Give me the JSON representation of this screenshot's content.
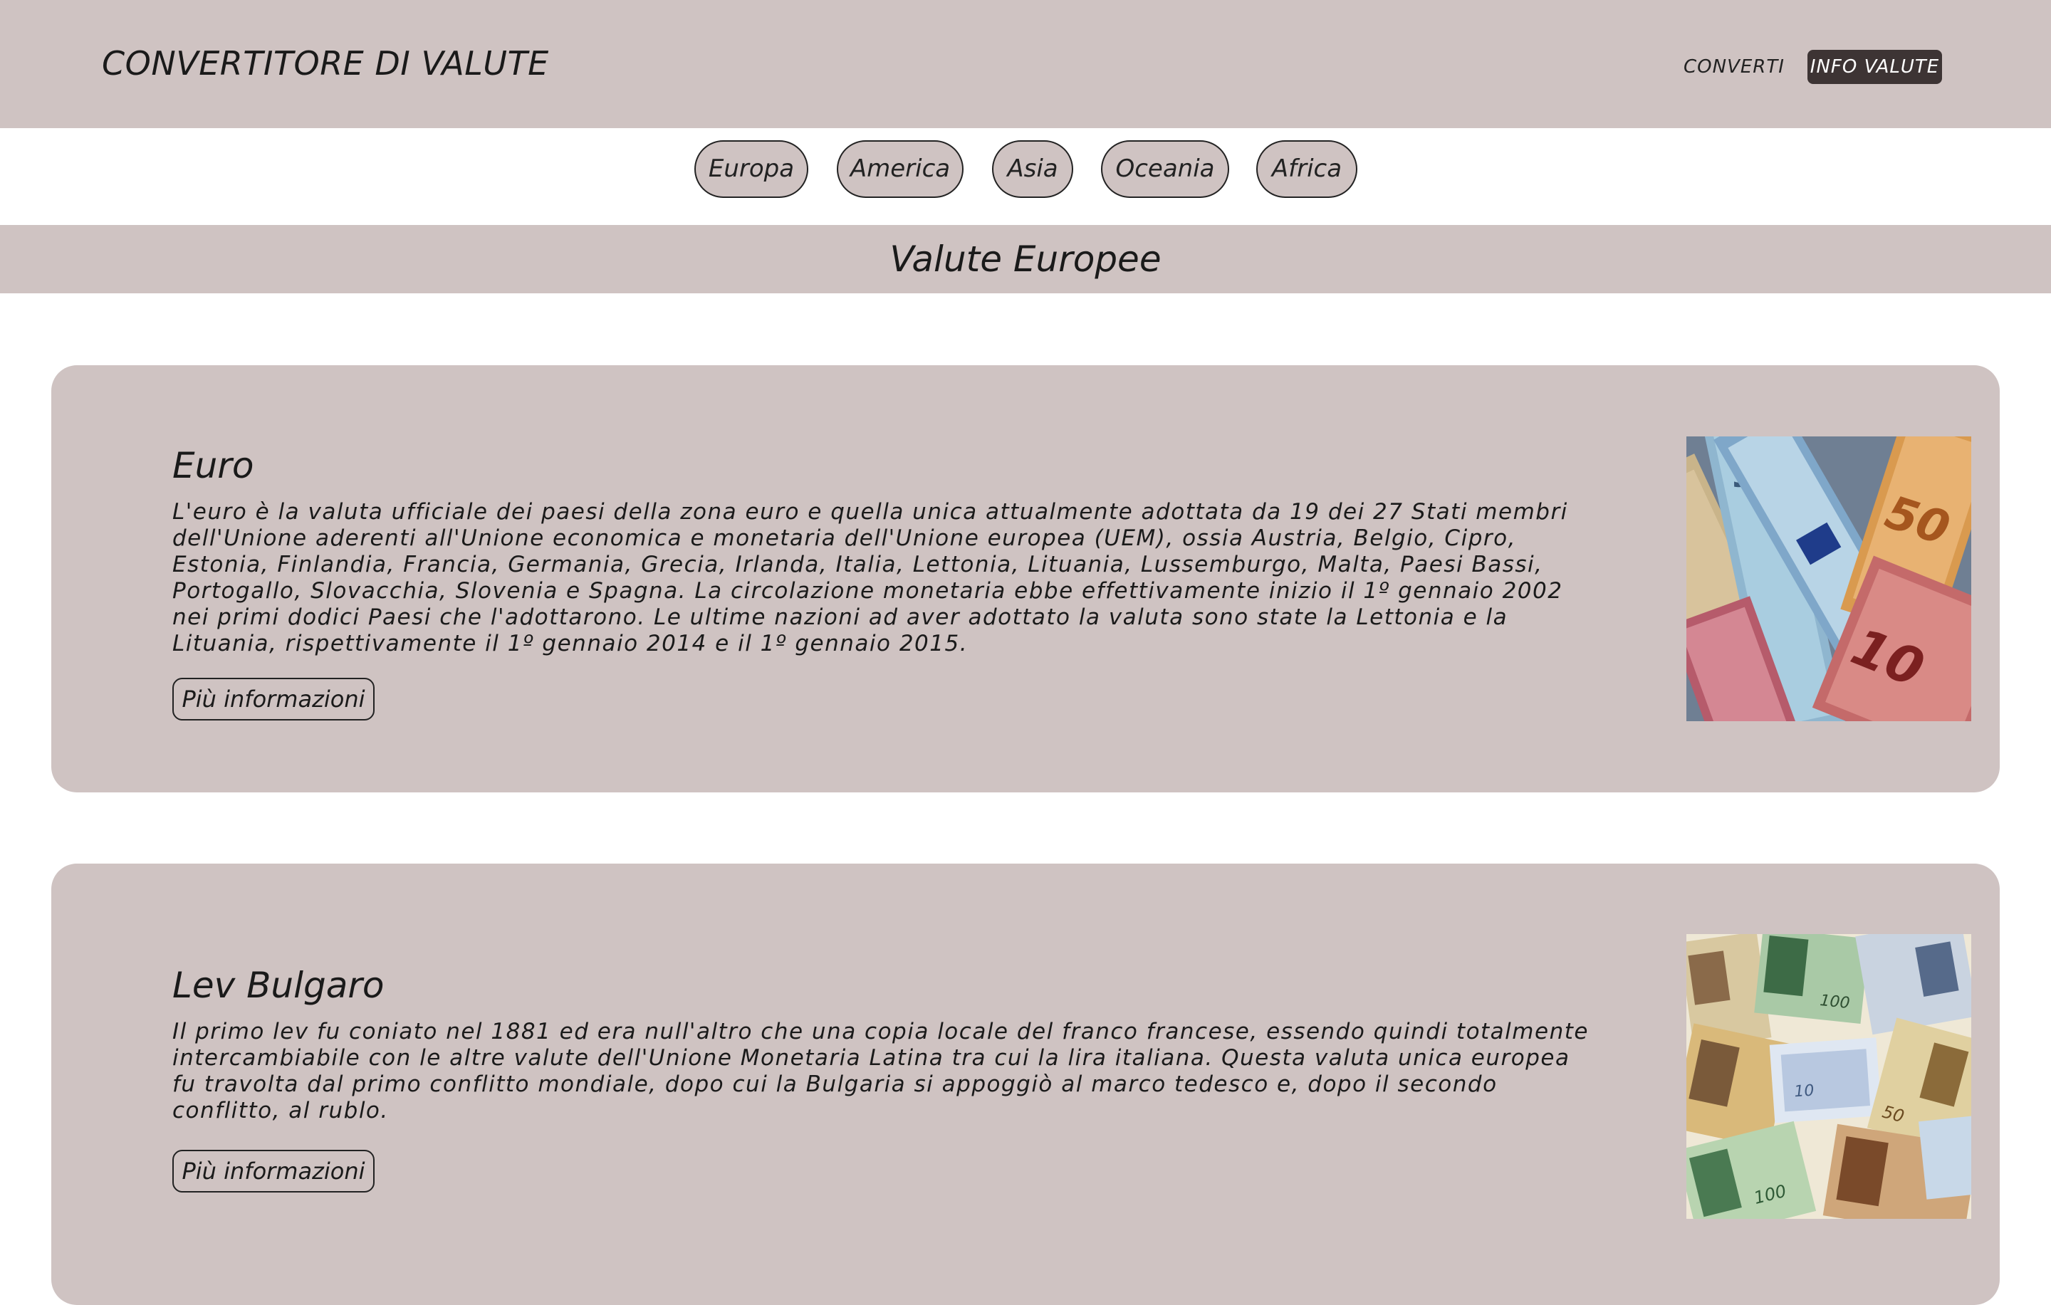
{
  "header": {
    "brand": "CONVERTITORE DI VALUTE",
    "nav": {
      "converti": "CONVERTI",
      "info_valute": "INFO VALUTE"
    }
  },
  "regions": [
    "Europa",
    "America",
    "Asia",
    "Oceania",
    "Africa"
  ],
  "section_title": "Valute Europee",
  "currencies": [
    {
      "title": "Euro",
      "description": "L'euro è la valuta ufficiale dei paesi della zona euro e quella unica attualmente adottata da 19 dei 27 Stati membri dell'Unione aderenti all'Unione economica e monetaria dell'Unione europea (UEM), ossia Austria, Belgio, Cipro, Estonia, Finlandia, Francia, Germania, Grecia, Irlanda, Italia, Lettonia, Lituania, Lussemburgo, Malta, Paesi Bassi, Portogallo, Slovacchia, Slovenia e Spagna. La circolazione monetaria ebbe effettivamente inizio il 1º gennaio 2002 nei primi dodici Paesi che l'adottarono. Le ultime nazioni ad aver adottato la valuta sono state la Lettonia e la Lituania, rispettivamente il 1º gennaio 2014 e il 1º gennaio 2015.",
      "button": "Più informazioni"
    },
    {
      "title": "Lev Bulgaro",
      "description": "Il primo lev fu coniato nel 1881 ed era null'altro che una copia locale del franco francese, essendo quindi totalmente intercambiabile con le altre valute dell'Unione Monetaria Latina tra cui la lira italiana. Questa valuta unica europea fu travolta dal primo conflitto mondiale, dopo cui la Bulgaria si appoggiò al marco tedesco e, dopo il secondo conflitto, al rublo.",
      "button": "Più informazioni"
    }
  ],
  "colors": {
    "band": "#cfc3c2",
    "nav_active_bg": "#3d3434",
    "text": "#1a1a1a"
  }
}
